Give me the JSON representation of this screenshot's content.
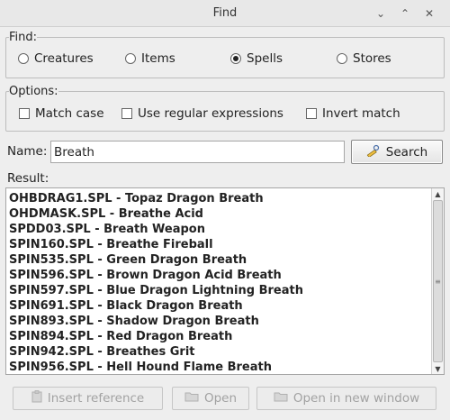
{
  "window": {
    "title": "Find"
  },
  "find": {
    "label": "Find:",
    "options": [
      {
        "label": "Creatures",
        "selected": false
      },
      {
        "label": "Items",
        "selected": false
      },
      {
        "label": "Spells",
        "selected": true
      },
      {
        "label": "Stores",
        "selected": false
      }
    ]
  },
  "options": {
    "label": "Options:",
    "checks": [
      {
        "label": "Match case",
        "checked": false
      },
      {
        "label": "Use regular expressions",
        "checked": false
      },
      {
        "label": "Invert match",
        "checked": false
      }
    ]
  },
  "name": {
    "label": "Name:",
    "value": "Breath"
  },
  "search_label": "Search",
  "result": {
    "label": "Result:",
    "rows": [
      "OHBDRAG1.SPL - Topaz Dragon Breath",
      "OHDMASK.SPL - Breathe Acid",
      "SPDD03.SPL - Breath Weapon",
      "SPIN160.SPL - Breathe Fireball",
      "SPIN535.SPL - Green Dragon Breath",
      "SPIN596.SPL - Brown Dragon Acid Breath",
      "SPIN597.SPL - Blue Dragon Lightning Breath",
      "SPIN691.SPL - Black Dragon Breath",
      "SPIN893.SPL - Shadow Dragon Breath",
      "SPIN894.SPL - Red Dragon Breath",
      "SPIN942.SPL - Breathes Grit",
      "SPIN956.SPL - Hell Hound Flame Breath"
    ]
  },
  "buttons": {
    "insert_reference": "Insert reference",
    "open": "Open",
    "open_new_window": "Open in new window"
  },
  "icons": {
    "minimize": "minimize-icon",
    "maximize": "maximize-icon",
    "close": "close-icon",
    "search": "pencil-magnifier-icon",
    "insert": "clipboard-icon",
    "open": "folder-icon"
  }
}
